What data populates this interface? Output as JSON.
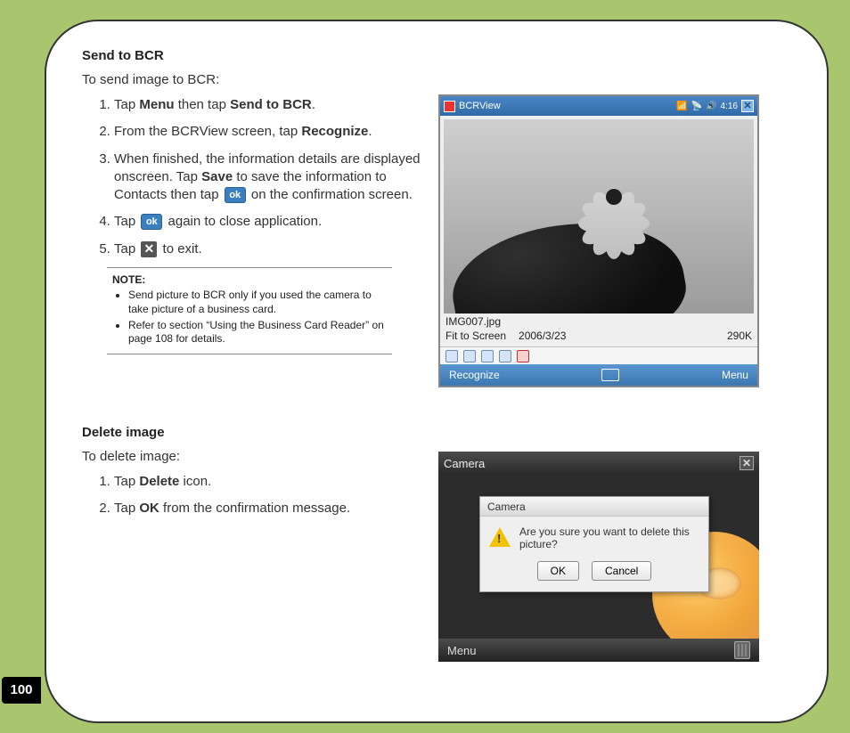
{
  "page_number": "100",
  "send_bcr": {
    "heading": "Send to BCR",
    "intro": "To send image to BCR:",
    "step1_a": "Tap ",
    "step1_m1": "Menu",
    "step1_b": " then tap ",
    "step1_m2": "Send to BCR",
    "step1_c": ".",
    "step2_a": "From the BCRView screen, tap ",
    "step2_m1": "Recognize",
    "step2_b": ".",
    "step3_a": "When finished, the information details are displayed onscreen. Tap ",
    "step3_m1": "Save",
    "step3_b": " to save the information to Contacts then tap ",
    "step3_c": " on the confirmation screen.",
    "step4_a": "Tap ",
    "step4_b": " again to close application.",
    "step5_a": "Tap ",
    "step5_b": " to exit.",
    "ok_label": "ok",
    "x_label": "✕",
    "note_title": "NOTE:",
    "note1": "Send picture to BCR only if you used the camera to take picture of a business card.",
    "note2": "Refer to section “Using the Business Card Reader” on page 108 for details."
  },
  "delete_img": {
    "heading": "Delete image",
    "intro": "To delete image:",
    "step1_a": "Tap ",
    "step1_m1": "Delete",
    "step1_b": " icon.",
    "step2_a": "Tap ",
    "step2_m1": "OK",
    "step2_b": " from the confirmation message."
  },
  "bcrview_shot": {
    "app_title": "BCRView",
    "status_right": "4:16",
    "close": "✕",
    "filename": "IMG007.jpg",
    "fit": "Fit to Screen",
    "date": "2006/3/23",
    "size": "290K",
    "soft_left": "Recognize",
    "soft_right": "Menu"
  },
  "camera_shot": {
    "top_title": "Camera",
    "top_close": "✕",
    "dlg_title": "Camera",
    "dlg_msg": "Are you sure you want to delete this picture?",
    "ok": "OK",
    "cancel": "Cancel",
    "soft_left": "Menu"
  }
}
